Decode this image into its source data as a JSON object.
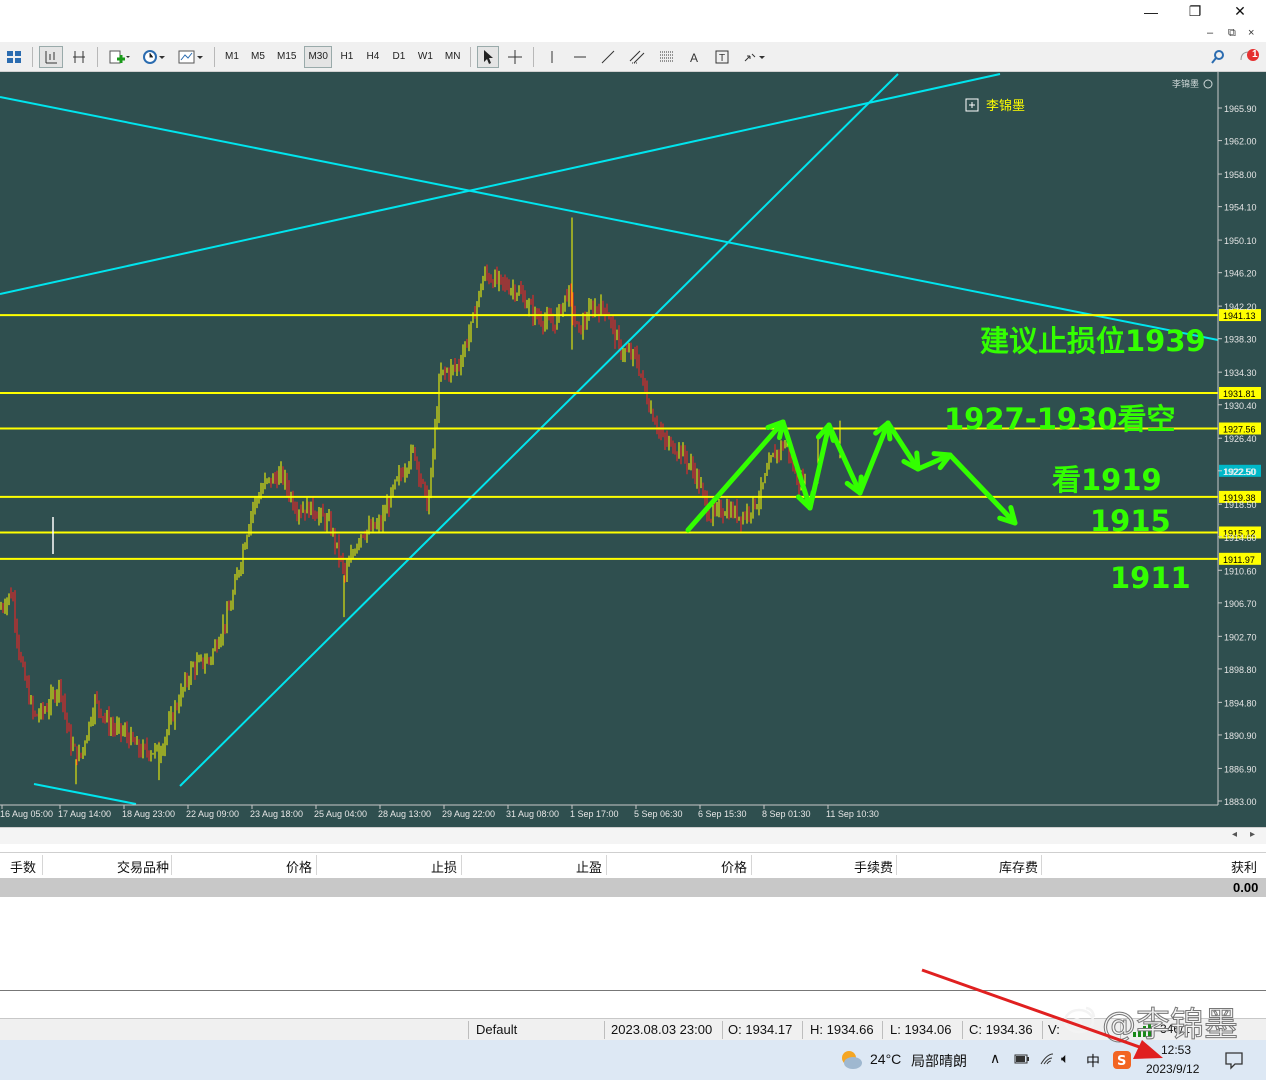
{
  "window": {
    "minimize_glyph": "—",
    "restore_glyph": "❐",
    "close_glyph": "✕",
    "mdi_glyphs": [
      "–",
      "⧉",
      "×"
    ]
  },
  "toolbar": {
    "timeframes": [
      "M1",
      "M5",
      "M15",
      "M30",
      "H1",
      "H4",
      "D1",
      "W1",
      "MN"
    ],
    "active_timeframe": "M30",
    "icons": [
      "profiles-icon",
      "chart-bars-icon",
      "chart-crosshair-icon",
      "new-order-icon",
      "clock-icon",
      "chart-settings-icon",
      "cursor-icon",
      "crosshair-icon",
      "vertical-line-icon",
      "horizontal-line-icon",
      "trendline-icon",
      "fibo-icon",
      "channel-icon",
      "text-icon",
      "label-icon",
      "arrows-icon",
      "search-icon",
      "notification-icon"
    ],
    "notification_count": "1"
  },
  "chart": {
    "background": "#2f4f4f",
    "grid_color": "#2f4f4f",
    "bull_color": "#ffff00",
    "bear_color": "#ff2020",
    "level_color": "#ffff00",
    "trendline_color": "#00e5ee",
    "annotation_color": "#33ff00",
    "indicator_label": "李锦墨",
    "watermark_label": "李锦墨",
    "price_ticks": [
      "1965.90",
      "1962.00",
      "1958.00",
      "1954.10",
      "1950.10",
      "1946.20",
      "1942.20",
      "1938.30",
      "1934.30",
      "1930.40",
      "1926.40",
      "1922.50",
      "1918.50",
      "1914.60",
      "1910.60",
      "1906.70",
      "1902.70",
      "1898.80",
      "1894.80",
      "1890.90",
      "1886.90",
      "1883.00"
    ],
    "time_ticks": [
      "16 Aug 05:00",
      "17 Aug 14:00",
      "18 Aug 23:00",
      "22 Aug 09:00",
      "23 Aug 18:00",
      "25 Aug 04:00",
      "28 Aug 13:00",
      "29 Aug 22:00",
      "31 Aug 08:00",
      "1 Sep 17:00",
      "5 Sep 06:30",
      "6 Sep 15:30",
      "8 Sep 01:30",
      "11 Sep 10:30"
    ],
    "levels": [
      {
        "price": 1941.13,
        "label": "1941.13"
      },
      {
        "price": 1931.81,
        "label": "1931.81"
      },
      {
        "price": 1927.56,
        "label": "1927.56"
      },
      {
        "price": 1919.38,
        "label": "1919.38"
      },
      {
        "price": 1915.12,
        "label": "1915.12"
      },
      {
        "price": 1911.97,
        "label": "1911.97"
      }
    ],
    "current_price": {
      "price": 1922.5,
      "label": "1922.50"
    },
    "annotations": [
      "建议止损位1939",
      "1927-1930看空",
      "看1919",
      "1915",
      "1911"
    ]
  },
  "terminal": {
    "columns": [
      "手数",
      "交易品种",
      "价格",
      "止损",
      "止盈",
      "价格",
      "手续费",
      "库存费",
      "获利"
    ],
    "balance_profit": "0.00"
  },
  "statusbar": {
    "profile": "Default",
    "datetime": "2023.08.03 23:00",
    "open": "O: 1934.17",
    "high": "H: 1934.66",
    "low": "L: 1934.06",
    "close": "C: 1934.36",
    "volume": "V:",
    "traffic": "346/1"
  },
  "taskbar": {
    "weather_temp": "24°C",
    "weather_text": "局部晴朗",
    "ime_label": "中",
    "time": "12:53",
    "date": "2023/9/12",
    "watermark": "@李锦墨"
  }
}
